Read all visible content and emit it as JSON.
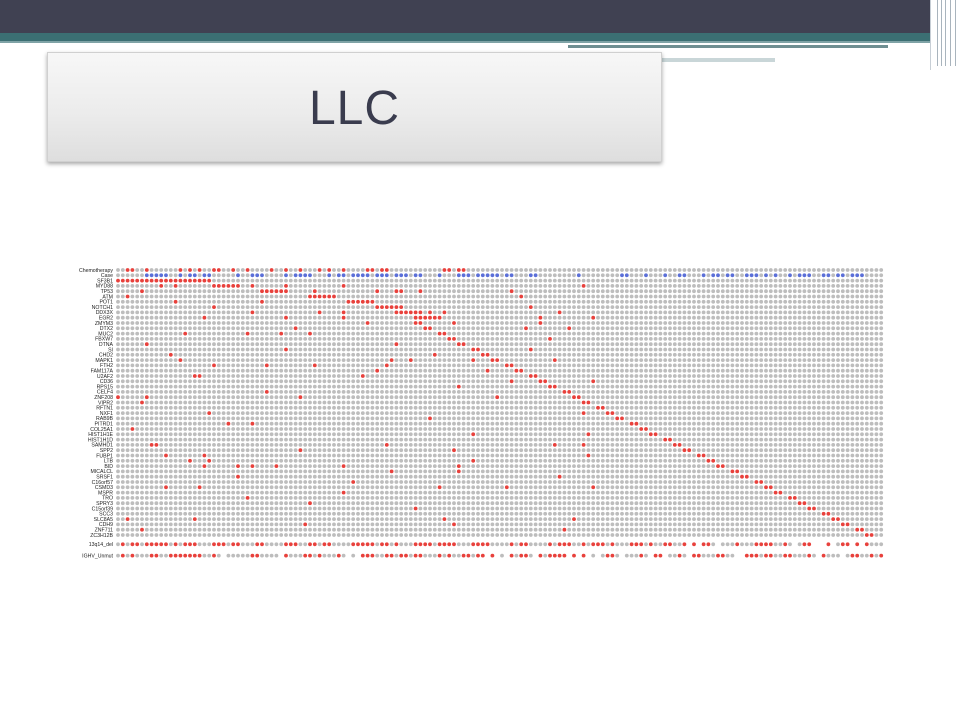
{
  "slide": {
    "title": "LLC"
  },
  "colors": {
    "top_bar": "#404152",
    "accent_strip": "#3b6f73",
    "mutated": "#e8413c",
    "wildtype": "#bdbdbd",
    "case_blue": "#5b6fd8"
  },
  "chart_data": {
    "type": "heatmap",
    "title": "",
    "legend": "none",
    "n_cases": 160,
    "rows": [
      "Chemotherapy",
      "Case",
      "SF3B1",
      "MYD88",
      "TP53",
      "ATM",
      "POT1",
      "NOTCH1",
      "DDX3X",
      "EGR2",
      "ZMYM3",
      "DTX2",
      "MUC2",
      "FBXW7",
      "DTNA",
      "SI",
      "CHD2",
      "MAPK1",
      "FTH2",
      "FAM117A",
      "U2AF2",
      "CD36",
      "RPS15",
      "CELF4",
      "ZNF208",
      "VIPR2",
      "RFTN1",
      "NXF1",
      "RAB9B",
      "PITRD1",
      "COL25A1",
      "HIST1H1E",
      "HIST1H1D",
      "SAMHD1",
      "SPP2",
      "FUBP1",
      "LTB",
      "BID",
      "MICALCL",
      "SRSF1",
      "C16orf57",
      "CSMD3",
      "MSPR",
      "TRO",
      "SPRY3",
      "C15orf39",
      "SCC3",
      "SLC8A5",
      "CDH9",
      "ZNF711",
      "ZC3H12B",
      "13q14_del",
      "IGHV_Unmut"
    ]
  }
}
